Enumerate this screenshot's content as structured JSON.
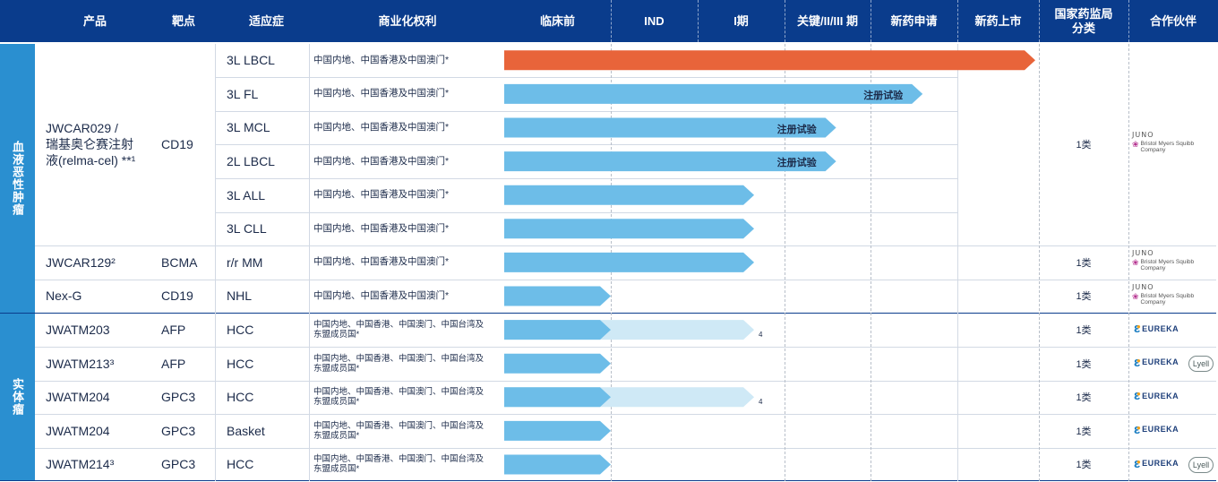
{
  "header": {
    "product": "产品",
    "target": "靶点",
    "indication": "适应症",
    "rights": "商业化权利",
    "phases": [
      "临床前",
      "IND",
      "I期",
      "关键/II/III 期",
      "新药申请",
      "新药上市"
    ],
    "nmpa": [
      "国家药监局",
      "分类"
    ],
    "partner": "合作伙伴"
  },
  "groups": [
    {
      "label": "血液恶性肿瘤"
    },
    {
      "label": "实体瘤"
    }
  ],
  "products": [
    {
      "name_lines": [
        "JWCAR029 /",
        "瑞基奥仑赛注射",
        "液(relma-cel) **¹"
      ],
      "target": "CD19",
      "nmpa": "1类",
      "partner": "juno-bms"
    },
    {
      "name": "JWCAR129²",
      "target": "BCMA",
      "nmpa": "1类",
      "partner": "juno-bms"
    },
    {
      "name": "Nex-G",
      "target": "CD19",
      "nmpa": "1类",
      "partner": "juno-bms"
    },
    {
      "name": "JWATM203",
      "target": "AFP",
      "nmpa": "1类",
      "partner": "eureka"
    },
    {
      "name": "JWATM213³",
      "target": "AFP",
      "nmpa": "1类",
      "partner": "eureka-lyell"
    },
    {
      "name": "JWATM204",
      "target": "GPC3",
      "nmpa": "1类",
      "partner": "eureka"
    },
    {
      "name": "JWATM204",
      "target": "GPC3",
      "nmpa": "1类",
      "partner": "eureka"
    },
    {
      "name": "JWATM214³",
      "target": "GPC3",
      "nmpa": "1类",
      "partner": "eureka-lyell"
    }
  ],
  "rows": [
    {
      "indication": "3L LBCL",
      "rights": [
        "中国内地、中国香港及中国澳门*"
      ],
      "phase_end": 6,
      "color": "#e8643a",
      "label": ""
    },
    {
      "indication": "3L FL",
      "rights": [
        "中国内地、中国香港及中国澳门*"
      ],
      "phase_end": 4.6,
      "color": "#6dbde8",
      "label": "注册试验"
    },
    {
      "indication": "3L MCL",
      "rights": [
        "中国内地、中国香港及中国澳门*"
      ],
      "phase_end": 3.6,
      "color": "#6dbde8",
      "label": "注册试验"
    },
    {
      "indication": "2L LBCL",
      "rights": [
        "中国内地、中国香港及中国澳门*"
      ],
      "phase_end": 3.6,
      "color": "#6dbde8",
      "label": "注册试验"
    },
    {
      "indication": "3L ALL",
      "rights": [
        "中国内地、中国香港及中国澳门*"
      ],
      "phase_end": 2.65,
      "color": "#6dbde8",
      "label": ""
    },
    {
      "indication": "3L CLL",
      "rights": [
        "中国内地、中国香港及中国澳门*"
      ],
      "phase_end": 2.65,
      "color": "#6dbde8",
      "label": ""
    },
    {
      "indication": "r/r MM",
      "rights": [
        "中国内地、中国香港及中国澳门*"
      ],
      "phase_end": 2.65,
      "color": "#6dbde8",
      "label": ""
    },
    {
      "indication": "NHL",
      "rights": [
        "中国内地、中国香港及中国澳门*"
      ],
      "phase_end": 1.0,
      "color": "#6dbde8",
      "label": ""
    },
    {
      "indication": "HCC",
      "rights": [
        "中国内地、中国香港、中国澳门、中国台湾及",
        "东盟成员国*"
      ],
      "phase_end": 1.0,
      "color": "#6dbde8",
      "label": "",
      "ext_end": 2.65,
      "footnote": "4"
    },
    {
      "indication": "HCC",
      "rights": [
        "中国内地、中国香港、中国澳门、中国台湾及",
        "东盟成员国*"
      ],
      "phase_end": 1.0,
      "color": "#6dbde8",
      "label": ""
    },
    {
      "indication": "HCC",
      "rights": [
        "中国内地、中国香港、中国澳门、中国台湾及",
        "东盟成员国*"
      ],
      "phase_end": 1.0,
      "color": "#6dbde8",
      "label": "",
      "ext_end": 2.65,
      "footnote": "4"
    },
    {
      "indication": "Basket",
      "rights": [
        "中国内地、中国香港、中国澳门、中国台湾及",
        "东盟成员国*"
      ],
      "phase_end": 1.0,
      "color": "#6dbde8",
      "label": ""
    },
    {
      "indication": "HCC",
      "rights": [
        "中国内地、中国香港、中国澳门、中国台湾及",
        "东盟成员国*"
      ],
      "phase_end": 1.0,
      "color": "#6dbde8",
      "label": ""
    }
  ],
  "partners": {
    "juno": "JUNO",
    "bms": [
      "Bristol Myers Squibb",
      "Company"
    ],
    "eureka": "EUREKA",
    "lyell": "Lyell"
  },
  "colors": {
    "header_bg": "#0a3c8c",
    "group_bg": "#2a8fd0",
    "bar_blue": "#6dbde8",
    "bar_orange": "#e8643a",
    "bar_light": "#cfe9f6"
  }
}
